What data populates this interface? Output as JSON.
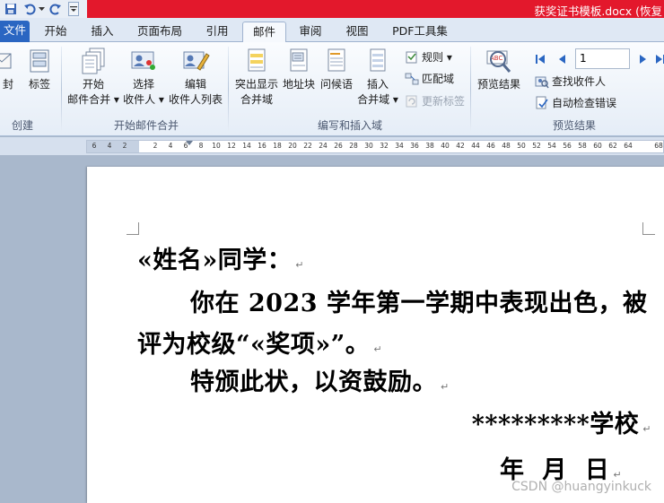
{
  "window": {
    "title": "获奖证书模板.docx (恢复"
  },
  "quick_access": {
    "save": "save-icon",
    "undo": "undo-icon",
    "redo": "redo-icon",
    "customize": "customize-arrow-icon"
  },
  "tabs": [
    {
      "label": "文件"
    },
    {
      "label": "开始"
    },
    {
      "label": "插入"
    },
    {
      "label": "页面布局"
    },
    {
      "label": "引用"
    },
    {
      "label": "邮件"
    },
    {
      "label": "审阅"
    },
    {
      "label": "视图"
    },
    {
      "label": "PDF工具集"
    }
  ],
  "ribbon": {
    "create": {
      "label": "创建",
      "envelope": "封",
      "labels": "标签"
    },
    "start_merge": {
      "label": "开始邮件合并",
      "start": [
        "开始",
        "邮件合并 ▾"
      ],
      "select": [
        "选择",
        "收件人 ▾"
      ],
      "edit": [
        "编辑",
        "收件人列表"
      ]
    },
    "write_insert": {
      "label": "编写和插入域",
      "highlight": [
        "突出显示",
        "合并域"
      ],
      "address": "地址块",
      "greeting": "问候语",
      "insert_field": [
        "插入",
        "合并域 ▾"
      ],
      "rules": "规则 ▾",
      "match": "匹配域",
      "update": "更新标签"
    },
    "preview": {
      "label": "预览结果",
      "preview_btn": "预览结果",
      "record_value": "1",
      "find": "查找收件人",
      "auto_check": "自动检查错误"
    }
  },
  "ruler": {
    "numbers": [
      "6",
      "4",
      "2",
      "",
      "2",
      "4",
      "6",
      "8",
      "10",
      "12",
      "14",
      "16",
      "18",
      "20",
      "22",
      "24",
      "26",
      "28",
      "30",
      "32",
      "34",
      "36",
      "38",
      "40",
      "42",
      "44",
      "46",
      "48",
      "50",
      "52",
      "54",
      "56",
      "58",
      "60",
      "62",
      "64",
      "",
      "68"
    ]
  },
  "document": {
    "line1": "«姓名»同学：",
    "line2": "你在 2023 学年第一学期中表现出色，被",
    "line3": "评为校级“«奖项»”。",
    "line4": "特颁此状，以资鼓励。",
    "line5": "*********学校",
    "line6": "年 月  日",
    "para_mark": "↵"
  },
  "watermark": "CSDN @huangyinkuck"
}
